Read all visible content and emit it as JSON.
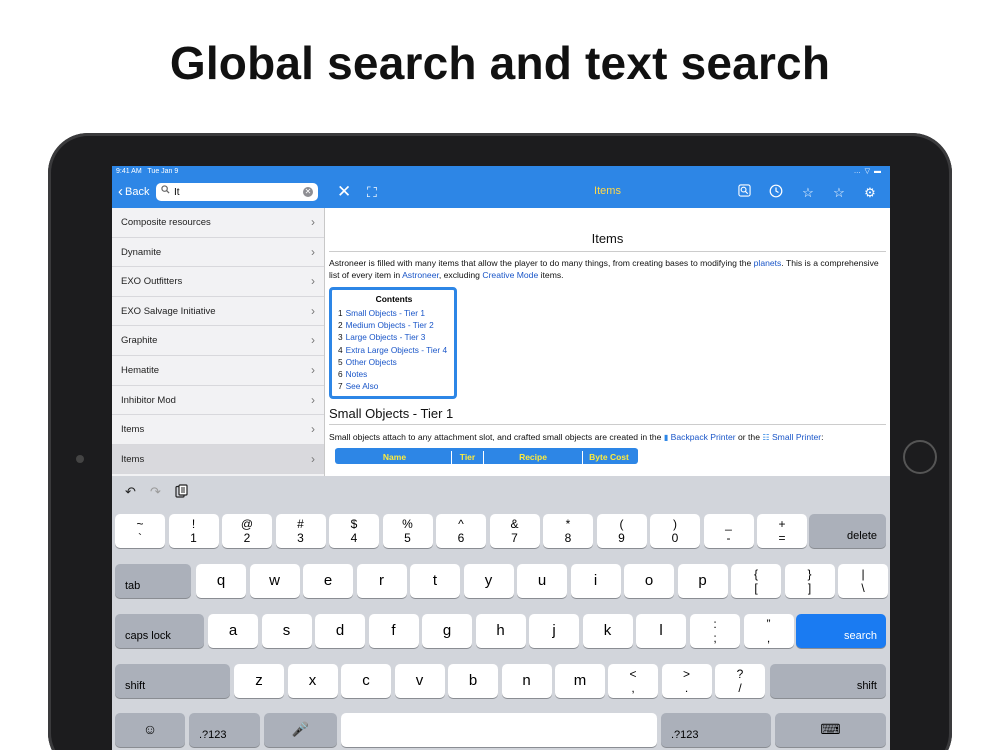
{
  "headline": "Global search and text search",
  "status": {
    "time": "9:41 AM",
    "date": "Tue Jan 9",
    "icons": "… ▽ ▬"
  },
  "nav": {
    "back_label": "Back",
    "search_value": "It",
    "search_placeholder": "",
    "title": "Items"
  },
  "list": {
    "items": [
      {
        "label": "Composite resources"
      },
      {
        "label": "Dynamite"
      },
      {
        "label": "EXO Outfitters"
      },
      {
        "label": "EXO Salvage Initiative"
      },
      {
        "label": "Graphite"
      },
      {
        "label": "Hematite"
      },
      {
        "label": "Inhibitor Mod"
      },
      {
        "label": "Items"
      },
      {
        "label": "Items",
        "selected": true
      }
    ]
  },
  "article": {
    "title": "Items",
    "intro": {
      "t1": "Astroneer is filled with many items that allow the player to do many things, from creating bases to modifying the ",
      "l1": "planets",
      "t2": ". This is a comprehensive list of every item in ",
      "l2": "Astroneer",
      "t3": ", excluding ",
      "l3": "Creative Mode",
      "t4": " items."
    },
    "toc": {
      "heading": "Contents",
      "items": [
        {
          "num": "1",
          "label": "Small Objects - Tier 1"
        },
        {
          "num": "2",
          "label": "Medium Objects - Tier 2"
        },
        {
          "num": "3",
          "label": "Large Objects - Tier 3"
        },
        {
          "num": "4",
          "label": "Extra Large Objects - Tier 4"
        },
        {
          "num": "5",
          "label": "Other Objects"
        },
        {
          "num": "6",
          "label": "Notes"
        },
        {
          "num": "7",
          "label": "See Also"
        }
      ]
    },
    "section_title": "Small Objects - Tier 1",
    "section_text": {
      "t1": "Small objects attach to any attachment slot, and crafted small objects are created in the ",
      "l1": "Backpack Printer",
      "t2": " or the ",
      "l2": "Small Printer",
      "t3": ":"
    },
    "table_headers": [
      "Name",
      "Tier",
      "Recipe",
      "Byte Cost"
    ]
  },
  "keyboard": {
    "row1": [
      {
        "top": "~",
        "bot": "`"
      },
      {
        "top": "!",
        "bot": "1"
      },
      {
        "top": "@",
        "bot": "2"
      },
      {
        "top": "#",
        "bot": "3"
      },
      {
        "top": "$",
        "bot": "4"
      },
      {
        "top": "%",
        "bot": "5"
      },
      {
        "top": "^",
        "bot": "6"
      },
      {
        "top": "&",
        "bot": "7"
      },
      {
        "top": "*",
        "bot": "8"
      },
      {
        "top": "(",
        "bot": "9"
      },
      {
        "top": ")",
        "bot": "0"
      },
      {
        "top": "_",
        "bot": "-"
      },
      {
        "top": "+",
        "bot": "="
      }
    ],
    "delete": "delete",
    "tab": "tab",
    "row2": [
      "q",
      "w",
      "e",
      "r",
      "t",
      "y",
      "u",
      "i",
      "o",
      "p"
    ],
    "row2_sym": [
      {
        "top": "{",
        "bot": "["
      },
      {
        "top": "}",
        "bot": "]"
      },
      {
        "top": "|",
        "bot": "\\"
      }
    ],
    "caps": "caps lock",
    "row3": [
      "a",
      "s",
      "d",
      "f",
      "g",
      "h",
      "j",
      "k",
      "l"
    ],
    "row3_sym": [
      {
        "top": ":",
        "bot": ";"
      },
      {
        "top": "”",
        "bot": ","
      }
    ],
    "search": "search",
    "shift": "shift",
    "row4": [
      "z",
      "x",
      "c",
      "v",
      "b",
      "n",
      "m"
    ],
    "row4_sym": [
      {
        "top": "<",
        "bot": ","
      },
      {
        "top": ">",
        "bot": "."
      },
      {
        "top": "?",
        "bot": "/"
      }
    ],
    "numbers": ".?123"
  }
}
